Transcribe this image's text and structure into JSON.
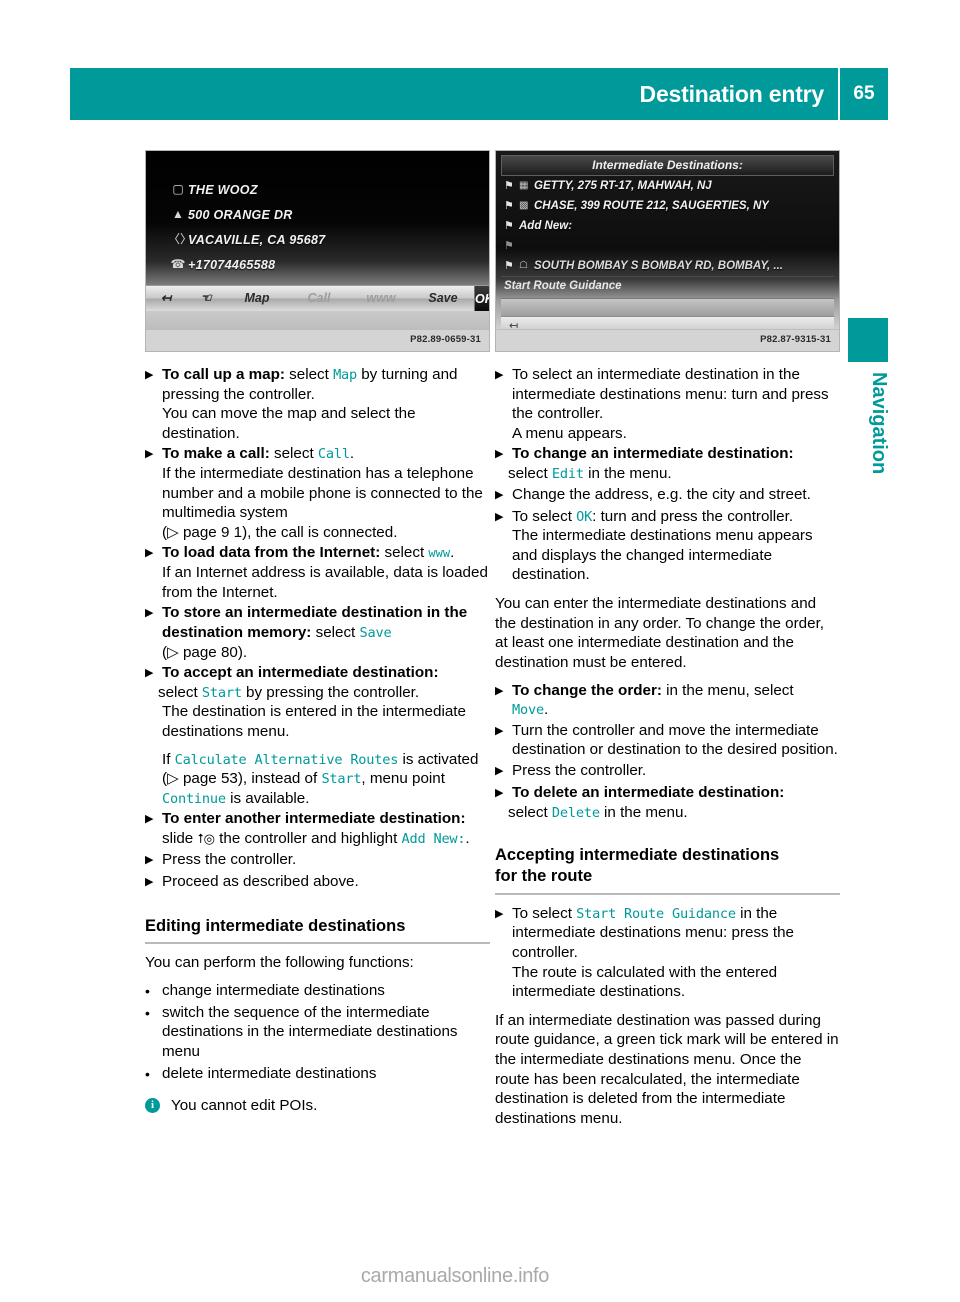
{
  "header": {
    "title": "Destination entry",
    "page_number": "65"
  },
  "side_tab": {
    "label": "Navigation"
  },
  "figures": {
    "left": {
      "caption_code": "P82.89-0659-31",
      "rows": [
        {
          "icon": "poi-icon",
          "text": "THE WOOZ"
        },
        {
          "icon": "house-icon",
          "text": "500 ORANGE DR"
        },
        {
          "icon": "city-icon",
          "text": "VACAVILLE, CA 95687"
        },
        {
          "icon": "phone-icon",
          "text": "+17074465588"
        }
      ],
      "toolbar": {
        "back_icon": "back-arrow-icon",
        "hand_icon": "hand-icon",
        "map": "Map",
        "call": "Call",
        "www": "www",
        "save": "Save",
        "ok": "OK"
      }
    },
    "right": {
      "caption_code": "P82.87-9315-31",
      "title": "Intermediate Destinations:",
      "rows": [
        {
          "flag": "flag-icon",
          "category": "fuel-icon",
          "text": "GETTY, 275 RT-17, MAHWAH, NJ"
        },
        {
          "flag": "flag-icon",
          "category": "bank-icon",
          "text": "CHASE, 399 ROUTE 212, SAUGERTIES, NY"
        },
        {
          "flag": "flag-icon",
          "category": "",
          "text": "Add New:"
        },
        {
          "flag": "flag-icon",
          "category": "",
          "text": ""
        },
        {
          "flag": "flag-icon",
          "category": "home-icon",
          "text": "SOUTH BOMBAY S BOMBAY RD, BOMBAY, ..."
        }
      ],
      "start_route_guidance": "Start Route Guidance",
      "back_icon": "back-arrow-icon"
    }
  },
  "left_column": {
    "steps": [
      {
        "lead": "To call up a map:",
        "after_lead": " select ",
        "mono": "Map",
        "tail": " by turning and pressing the controller.",
        "extra": "You can move the map and select the destination."
      },
      {
        "lead": "To make a call:",
        "after_lead": " select ",
        "mono": "Call",
        "tail": ".",
        "extra": "If the intermediate destination has a telephone number and a mobile phone is connected to the multimedia system",
        "ref_prefix": "(",
        "ref_arrow": "▷",
        "ref_text": " page 9 1), the call is connected."
      },
      {
        "lead": "To load data from the Internet:",
        "after_lead": " select ",
        "mono": "www",
        "tail": ".",
        "extra": "If an Internet address is available, data is loaded from the Internet."
      },
      {
        "lead": "To store an intermediate destination in the destination memory:",
        "after_lead": " select ",
        "mono": "Save",
        "tail": "",
        "ref_prefix": "(",
        "ref_arrow": "▷",
        "ref_text": " page 80)."
      },
      {
        "lead": "To accept an intermediate destination:",
        "after_lead": " select ",
        "mono": "Start",
        "tail": " by pressing the controller.",
        "extra": "The destination is entered in the intermediate destinations menu.",
        "sub_if_prefix": "If ",
        "sub_mono1": "Calculate Alternative Routes",
        "sub_mid": " is activated (",
        "sub_arrow": "▷",
        "sub_mid2": " page 53), instead of ",
        "sub_mono2": "Start",
        "sub_mid3": ", menu point ",
        "sub_mono3": "Continue",
        "sub_tail": " is available."
      },
      {
        "lead": "To enter another intermediate destination:",
        "after_lead": " slide ",
        "glyph": "⭡◎",
        "tail": " the controller and highlight ",
        "mono": "Add New:",
        "tail2": "."
      },
      {
        "plain": "Press the controller."
      },
      {
        "plain": "Proceed as described above."
      }
    ],
    "subhead": "Editing intermediate destinations",
    "intro": "You can perform the following functions:",
    "bullets": [
      "change intermediate destinations",
      "switch the sequence of the intermediate destinations in the intermediate destinations menu",
      "delete intermediate destinations"
    ],
    "note": "You cannot edit POIs."
  },
  "right_column": {
    "steps": [
      {
        "plain": "To select an intermediate destination in the intermediate destinations menu: turn and press the controller.",
        "extra": "A menu appears."
      },
      {
        "lead": "To change an intermediate destination:",
        "after_lead": " select ",
        "mono": "Edit",
        "tail": " in the menu."
      },
      {
        "plain": "Change the address, e.g. the city and street."
      },
      {
        "pre": "To select ",
        "mono": "OK",
        "tail": ": turn and press the controller.",
        "extra": "The intermediate destinations menu appears and displays the changed intermediate destination."
      }
    ],
    "para": "You can enter the intermediate destinations and the destination in any order. To change the order, at least one intermediate destination and the destination must be entered.",
    "steps2": [
      {
        "lead": "To change the order:",
        "after_lead": " in the menu, select ",
        "mono": "Move",
        "tail": "."
      },
      {
        "plain": "Turn the controller and move the intermediate destination or destination to the desired position."
      },
      {
        "plain": "Press the controller."
      },
      {
        "lead": "To delete an intermediate destination:",
        "after_lead": " select ",
        "mono": "Delete",
        "tail": " in the menu."
      }
    ],
    "subhead_line1": "Accepting intermediate destinations",
    "subhead_line2": "for the route",
    "final_step": {
      "pre": "To select ",
      "mono": "Start Route Guidance",
      "tail": " in the intermediate destinations menu: press the controller.",
      "extra": "The route is calculated with the entered intermediate destinations."
    },
    "final_para": "If an intermediate destination was passed during route guidance, a green tick mark will be entered in the intermediate destinations menu. Once the route has been recalculated, the intermediate destination is deleted from the intermediate destinations menu."
  },
  "watermark": "carmanualsonline.info",
  "colors": {
    "teal": "#009a9a",
    "rule": "#b9b9b9"
  }
}
